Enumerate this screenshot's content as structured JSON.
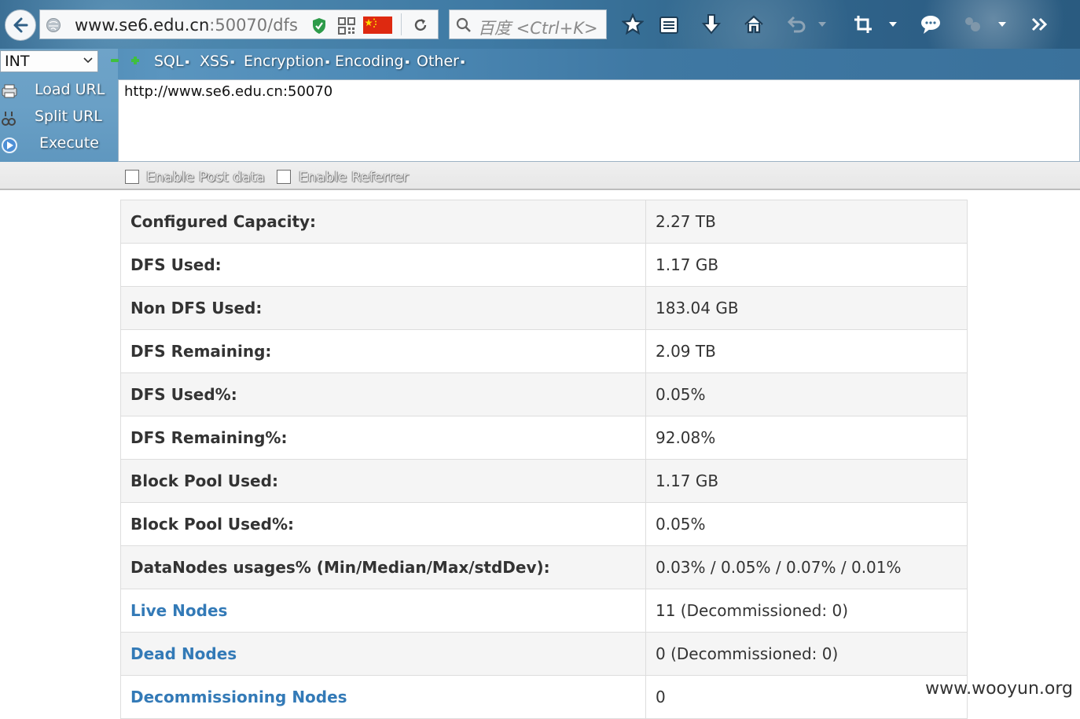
{
  "browser": {
    "url": {
      "host": "www.se6.edu.cn",
      "rest": ":50070/dfs"
    },
    "search_placeholder": "百度 <Ctrl+K>",
    "toolbar_icons": [
      "star-icon",
      "reading-list-icon",
      "download-icon",
      "home-icon",
      "undo-icon",
      "dropdown-icon",
      "crop-icon",
      "dropdown-icon",
      "chat-icon",
      "extension-icon",
      "dropdown-icon",
      "overflow-icon"
    ]
  },
  "hackbar": {
    "select_value": "INT",
    "menus": [
      "SQL",
      "XSS",
      "Encryption",
      "Encoding",
      "Other"
    ],
    "actions": [
      {
        "label": "Load URL",
        "icon": "load-url-icon"
      },
      {
        "label": "Split URL",
        "icon": "split-url-icon"
      },
      {
        "label": "Execute",
        "icon": "execute-icon"
      }
    ],
    "textarea_value": "http://www.se6.edu.cn:50070",
    "options": [
      {
        "label": "Enable Post data",
        "checked": false
      },
      {
        "label": "Enable Referrer",
        "checked": false
      }
    ]
  },
  "summary": {
    "rows": [
      {
        "key": "Configured Capacity:",
        "value": "2.27 TB"
      },
      {
        "key": "DFS Used:",
        "value": "1.17 GB"
      },
      {
        "key": "Non DFS Used:",
        "value": "183.04 GB"
      },
      {
        "key": "DFS Remaining:",
        "value": "2.09 TB"
      },
      {
        "key": "DFS Used%:",
        "value": "0.05%"
      },
      {
        "key": "DFS Remaining%:",
        "value": "92.08%"
      },
      {
        "key": "Block Pool Used:",
        "value": "1.17 GB"
      },
      {
        "key": "Block Pool Used%:",
        "value": "0.05%"
      },
      {
        "key": "DataNodes usages% (Min/Median/Max/stdDev):",
        "value": "0.03% / 0.05% / 0.07% / 0.01%"
      }
    ],
    "link_rows": [
      {
        "key": "Live Nodes",
        "value": "11 (Decommissioned: 0)"
      },
      {
        "key": "Dead Nodes",
        "value": "0 (Decommissioned: 0)"
      },
      {
        "key": "Decommissioning Nodes",
        "value": "0"
      }
    ]
  },
  "colors": {
    "link": "#337ab7",
    "row_alt": "#f5f5f5",
    "border": "#dddddd"
  },
  "watermark": "www.wooyun.org"
}
